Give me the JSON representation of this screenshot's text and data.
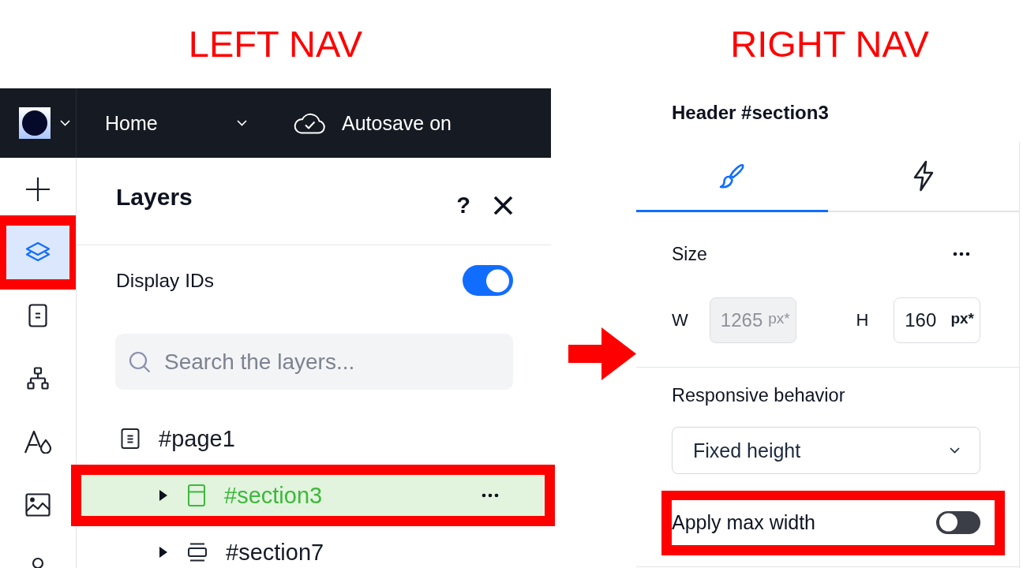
{
  "captions": [
    "LEFT NAV",
    "RIGHT NAV"
  ],
  "left_nav": {
    "top_bar": {
      "page": "Home",
      "autosave": "Autosave on"
    },
    "sidebar": {
      "items": [
        {
          "kind": "add",
          "selected": false,
          "highlighted": false
        },
        {
          "kind": "layers",
          "selected": true,
          "highlighted": true
        },
        {
          "kind": "pages",
          "selected": false,
          "highlighted": false
        },
        {
          "kind": "site_structure",
          "selected": false,
          "highlighted": false
        },
        {
          "kind": "theme",
          "selected": false,
          "highlighted": false
        },
        {
          "kind": "media",
          "selected": false,
          "highlighted": false
        },
        {
          "kind": "members",
          "selected": false,
          "highlighted": false
        }
      ]
    },
    "layers_panel": {
      "title": "Layers",
      "help": "?",
      "display_ids": {
        "label": "Display IDs",
        "on": true
      },
      "search": {
        "placeholder": "Search the layers..."
      },
      "tree": [
        {
          "label": "#page1",
          "kind": "page",
          "selected": false,
          "highlighted": false,
          "children": [
            {
              "label": "#section3",
              "kind": "section",
              "selected": true,
              "highlighted": true,
              "expanded": false
            },
            {
              "label": "#section7",
              "kind": "strip",
              "selected": false,
              "highlighted": false,
              "expanded": false
            }
          ]
        }
      ]
    }
  },
  "right_nav": {
    "title": "Header #section3",
    "tabs": [
      {
        "kind": "design",
        "selected": true
      },
      {
        "kind": "interactions",
        "selected": false
      }
    ],
    "size": {
      "label": "Size",
      "width": {
        "label": "W",
        "value": "1265",
        "unit": "px*",
        "disabled": true
      },
      "height": {
        "label": "H",
        "value": "160",
        "unit": "px*",
        "disabled": false
      }
    },
    "responsive": {
      "label": "Responsive behavior",
      "value": "Fixed height"
    },
    "max_width": {
      "label": "Apply max width",
      "on": false,
      "highlighted": true
    }
  }
}
